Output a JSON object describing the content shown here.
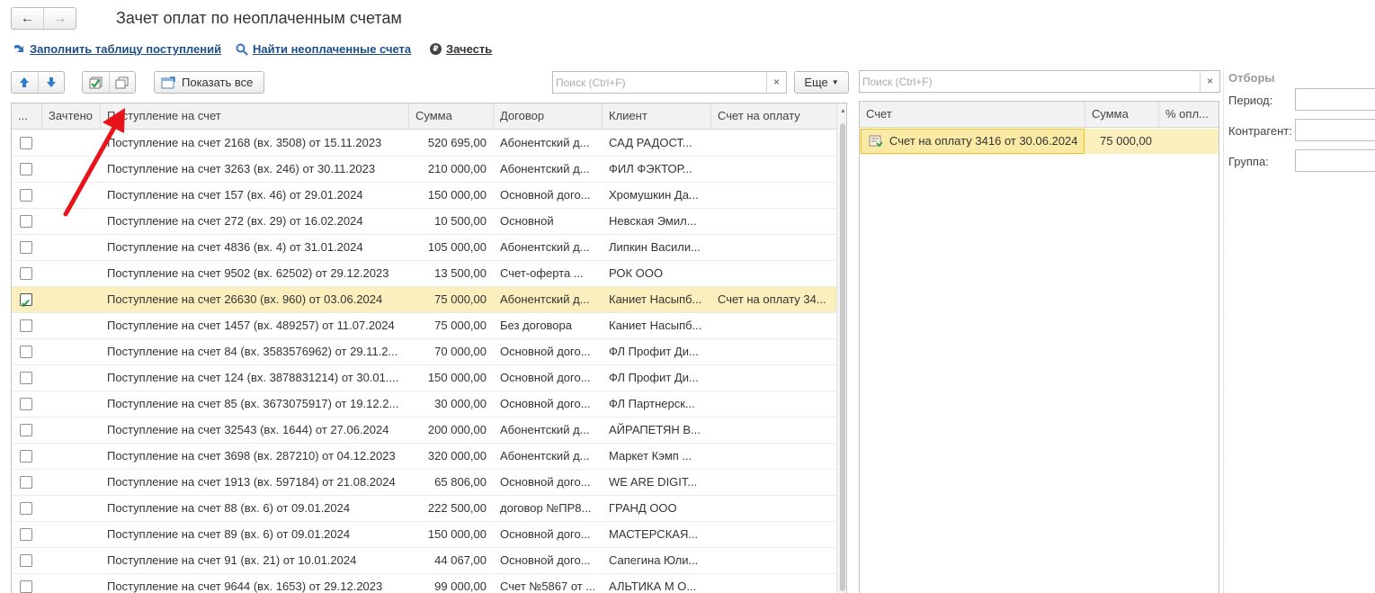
{
  "nav": {
    "back": "←",
    "forward": "→"
  },
  "window": {
    "title": "Зачет оплат по неоплаченным счетам"
  },
  "commands": {
    "fill": "Заполнить таблицу поступлений",
    "find": "Найти неоплаченные счета",
    "offset": "Зачесть",
    "offset_icon": "₽"
  },
  "toolbar": {
    "show_all": "Показать все",
    "more": "Еще",
    "search_placeholder": "Поиск (Ctrl+F)",
    "clear": "×"
  },
  "left_table": {
    "columns": [
      "...",
      "Зачтено",
      "Поступление на счет",
      "Сумма",
      "Договор",
      "Клиент",
      "Счет на оплату"
    ],
    "rows": [
      {
        "checked": false,
        "doc": "Поступление на счет 2168 (вх. 3508) от 15.11.2023",
        "sum": "520 695,00",
        "contract": "Абонентский д...",
        "client": "САД РАДОСТ...",
        "invoice": ""
      },
      {
        "checked": false,
        "doc": "Поступление на счет 3263 (вх. 246) от 30.11.2023",
        "sum": "210 000,00",
        "contract": "Абонентский д...",
        "client": "ФИЛ ФЭКТОР...",
        "invoice": ""
      },
      {
        "checked": false,
        "doc": "Поступление на счет 157 (вх. 46) от 29.01.2024",
        "sum": "150 000,00",
        "contract": "Основной дого...",
        "client": "Хромушкин Да...",
        "invoice": ""
      },
      {
        "checked": false,
        "doc": "Поступление на счет 272 (вх. 29) от 16.02.2024",
        "sum": "10 500,00",
        "contract": "Основной",
        "client": "Невская Эмил...",
        "invoice": ""
      },
      {
        "checked": false,
        "doc": "Поступление на счет 4836 (вх. 4) от 31.01.2024",
        "sum": "105 000,00",
        "contract": "Абонентский д...",
        "client": "Липкин Васили...",
        "invoice": ""
      },
      {
        "checked": false,
        "doc": "Поступление на счет 9502 (вх. 62502) от 29.12.2023",
        "sum": "13 500,00",
        "contract": "Счет-оферта ...",
        "client": "РОК ООО",
        "invoice": ""
      },
      {
        "checked": true,
        "doc": "Поступление на счет 26630 (вх. 960) от 03.06.2024",
        "sum": "75 000,00",
        "contract": "Абонентский д...",
        "client": "Каниет Насыпб...",
        "invoice": "Счет на оплату 34..."
      },
      {
        "checked": false,
        "doc": "Поступление на счет 1457 (вх. 489257) от 11.07.2024",
        "sum": "75 000,00",
        "contract": "Без договора",
        "client": "Каниет Насыпб...",
        "invoice": ""
      },
      {
        "checked": false,
        "doc": "Поступление на счет 84 (вх. 3583576962) от 29.11.2...",
        "sum": "70 000,00",
        "contract": "Основной дого...",
        "client": "ФЛ Профит Ди...",
        "invoice": ""
      },
      {
        "checked": false,
        "doc": "Поступление на счет 124 (вх. 3878831214) от 30.01....",
        "sum": "150 000,00",
        "contract": "Основной дого...",
        "client": "ФЛ Профит Ди...",
        "invoice": ""
      },
      {
        "checked": false,
        "doc": "Поступление на счет 85 (вх. 3673075917) от 19.12.2...",
        "sum": "30 000,00",
        "contract": "Основной дого...",
        "client": "ФЛ Партнерск...",
        "invoice": ""
      },
      {
        "checked": false,
        "doc": "Поступление на счет 32543 (вх. 1644) от 27.06.2024",
        "sum": "200 000,00",
        "contract": "Абонентский д...",
        "client": "АЙРАПЕТЯН В...",
        "invoice": ""
      },
      {
        "checked": false,
        "doc": "Поступление на счет 3698 (вх. 287210) от 04.12.2023",
        "sum": "320 000,00",
        "contract": "Абонентский д...",
        "client": "Маркет Кэмп ...",
        "invoice": ""
      },
      {
        "checked": false,
        "doc": "Поступление на счет 1913 (вх. 597184) от 21.08.2024",
        "sum": "65 806,00",
        "contract": "Основной дого...",
        "client": "WE ARE DIGIT...",
        "invoice": ""
      },
      {
        "checked": false,
        "doc": "Поступление на счет 88 (вх. 6) от 09.01.2024",
        "sum": "222 500,00",
        "contract": "договор №ПР8...",
        "client": "ГРАНД ООО",
        "invoice": ""
      },
      {
        "checked": false,
        "doc": "Поступление на счет 89 (вх. 6) от 09.01.2024",
        "sum": "150 000,00",
        "contract": "Основной дого...",
        "client": "МАСТЕРСКАЯ...",
        "invoice": ""
      },
      {
        "checked": false,
        "doc": "Поступление на счет 91 (вх. 21) от 10.01.2024",
        "sum": "44 067,00",
        "contract": "Основной дого...",
        "client": "Сапегина Юли...",
        "invoice": ""
      },
      {
        "checked": false,
        "doc": "Поступление на счет 9644 (вх. 1653) от 29.12.2023",
        "sum": "99 000,00",
        "contract": "Счет №5867 от ...",
        "client": "АЛЬТИКА М О...",
        "invoice": ""
      }
    ]
  },
  "right_table": {
    "columns": [
      "Счет",
      "Сумма",
      "% опл..."
    ],
    "rows": [
      {
        "invoice": "Счет на оплату 3416 от 30.06.2024",
        "sum": "75 000,00",
        "percent": ""
      }
    ]
  },
  "filters": {
    "title": "Отборы",
    "period": "Период:",
    "counterparty": "Контрагент:",
    "group": "Группа:"
  },
  "colors": {
    "selected_row": "#fbf0bd",
    "link": "#1d4e89",
    "annotation_arrow": "#e8141c"
  }
}
